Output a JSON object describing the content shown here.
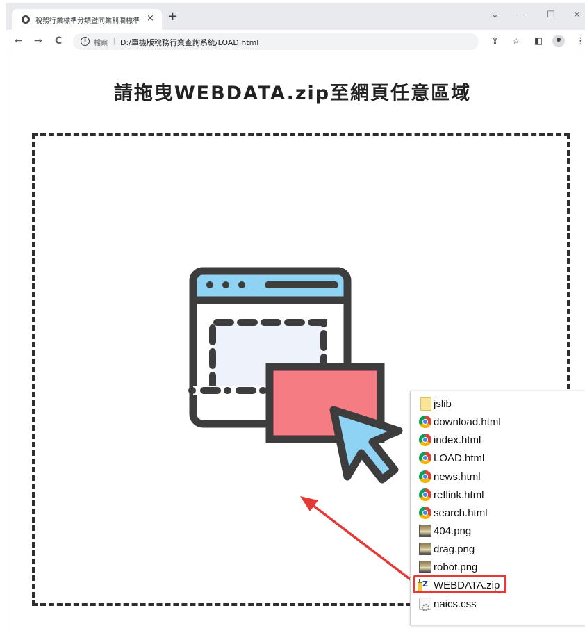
{
  "browser": {
    "tab_title": "稅務行業標準分類暨同業利潤標準",
    "tab_close": "×",
    "new_tab": "+",
    "window_controls": {
      "dropdown": "⌄",
      "minimize": "—",
      "maximize": "☐",
      "close": "✕"
    },
    "nav": {
      "back": "←",
      "forward": "→",
      "reload": "C"
    },
    "omnibox": {
      "info": "i",
      "label": "檔案",
      "separator": "|",
      "url": "D:/單機版稅務行業查詢系統/LOAD.html"
    },
    "toolbar_icons": {
      "share": "⇪",
      "star": "☆",
      "sidepanel": "◧",
      "menu": "⋮"
    }
  },
  "page": {
    "heading": "請拖曳WEBDATA.zip至網頁任意區域"
  },
  "explorer": {
    "files": [
      {
        "name": "jslib",
        "icon": "folder-icon"
      },
      {
        "name": "download.html",
        "icon": "chrome-html-icon"
      },
      {
        "name": "index.html",
        "icon": "chrome-html-icon"
      },
      {
        "name": "LOAD.html",
        "icon": "chrome-html-icon"
      },
      {
        "name": "news.html",
        "icon": "chrome-html-icon"
      },
      {
        "name": "reflink.html",
        "icon": "chrome-html-icon"
      },
      {
        "name": "search.html",
        "icon": "chrome-html-icon"
      },
      {
        "name": "404.png",
        "icon": "image-icon"
      },
      {
        "name": "drag.png",
        "icon": "image-icon"
      },
      {
        "name": "robot.png",
        "icon": "image-icon"
      },
      {
        "name": "WEBDATA.zip",
        "icon": "zip-icon"
      },
      {
        "name": "naics.css",
        "icon": "css-file-icon"
      }
    ],
    "highlighted": "WEBDATA.zip"
  },
  "colors": {
    "annotation_red": "#e53935",
    "illustration_dark": "#3d3d3d",
    "illustration_blue": "#8fd3f4",
    "illustration_pink": "#f47c82",
    "illustration_bg": "#eef3fb"
  }
}
